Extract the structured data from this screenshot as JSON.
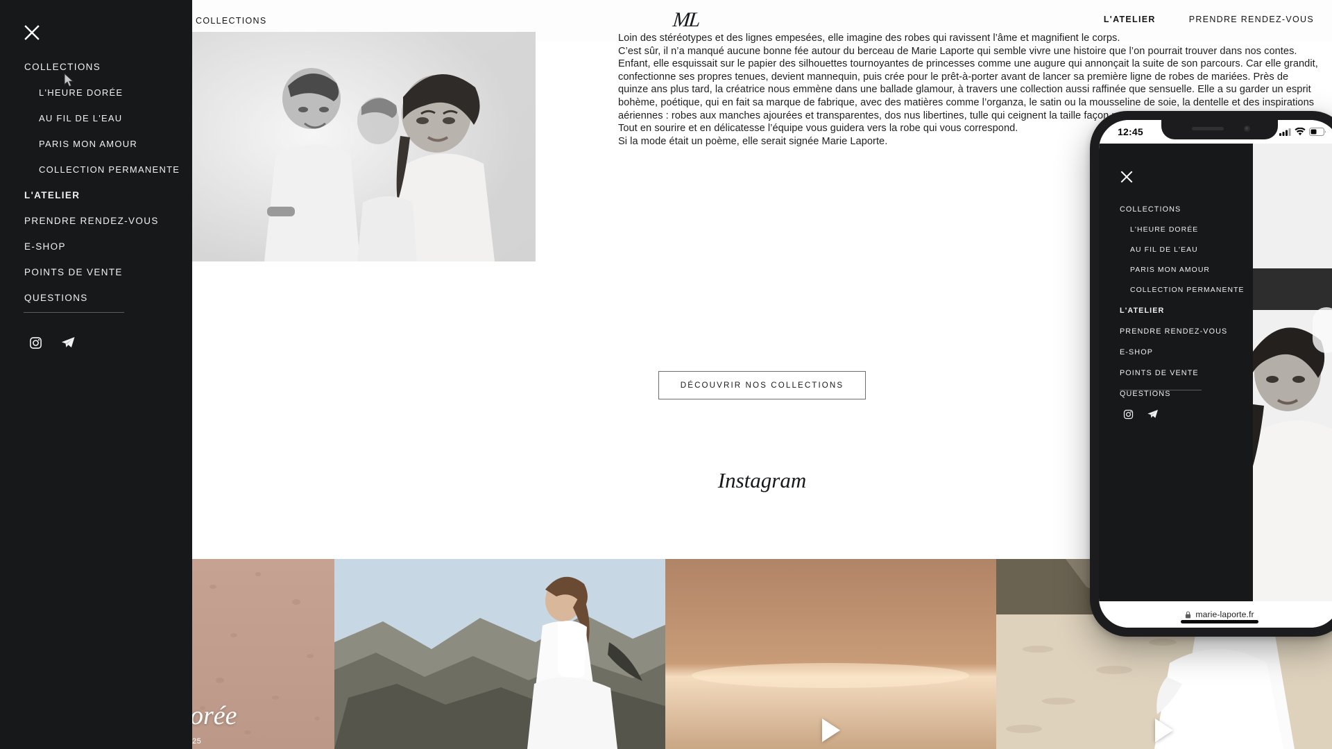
{
  "sidebar": {
    "close_icon": "close-x-icon",
    "items": [
      {
        "label": "COLLECTIONS",
        "level": "top",
        "active": false
      },
      {
        "label": "L'HEURE DORÉE",
        "level": "sub",
        "active": false
      },
      {
        "label": "AU FIL DE L'EAU",
        "level": "sub",
        "active": false
      },
      {
        "label": "PARIS MON AMOUR",
        "level": "sub",
        "active": false
      },
      {
        "label": "COLLECTION PERMANENTE",
        "level": "sub",
        "active": false
      },
      {
        "label": "L'ATELIER",
        "level": "top",
        "active": true
      },
      {
        "label": "PRENDRE RENDEZ-VOUS",
        "level": "top",
        "active": false
      },
      {
        "label": "E-SHOP",
        "level": "top",
        "active": false
      },
      {
        "label": "POINTS DE VENTE",
        "level": "top",
        "active": false
      },
      {
        "label": "QUESTIONS",
        "level": "top",
        "active": false
      }
    ],
    "social": [
      {
        "name": "instagram-icon"
      },
      {
        "name": "telegram-icon"
      }
    ]
  },
  "header": {
    "left_link": "COLLECTIONS",
    "logo": "ML",
    "right_links": [
      {
        "label": "L'ATELIER",
        "bold": true
      },
      {
        "label": "PRENDRE RENDEZ-VOUS",
        "bold": false
      }
    ]
  },
  "main": {
    "hero_image_alt": "atelier-fitting-photo",
    "paragraphs": [
      "Loin des stéréotypes et des lignes empesées, elle imagine des robes qui ravissent l’âme et magnifient le corps.",
      "C’est sûr, il n’a manqué aucune bonne fée autour du berceau de Marie Laporte qui semble vivre une histoire que l’on pourrait trouver dans nos contes. Enfant, elle esquissait sur le papier des silhouettes tournoyantes de princesses comme une augure qui annonçait la suite de son parcours. Car elle grandit, confectionne ses propres tenues, devient mannequin, puis crée pour le prêt-à-porter avant de lancer sa première ligne de robes de mariées. Près de quinze ans plus tard, la créatrice nous emmène dans une ballade glamour, à travers une collection aussi raffinée que sensuelle. Elle a su garder un esprit bohème, poétique, qui en fait sa marque de fabrique, avec des matières comme l’organza, le satin ou la mousseline de soie, la dentelle et des inspirations aériennes : robes aux manches ajourées et transparentes, dos nus libertines, tulle qui ceignent la taille façon nuage ...",
      "Tout en sourire et en délicatesse l’équipe vous guidera vers la robe qui vous correspond.",
      "Si la mode était un poème, elle serait signée Marie Laporte."
    ],
    "cta_label": "DÉCOUVRIR NOS COLLECTIONS",
    "instagram_heading": "Instagram",
    "gallery": [
      {
        "name": "tile-heure-doree",
        "caption": "dorée",
        "number": "25",
        "has_play": false
      },
      {
        "name": "tile-bride-rocks",
        "caption": "",
        "number": "",
        "has_play": false
      },
      {
        "name": "tile-beach-sunset",
        "caption": "",
        "number": "",
        "has_play": true
      },
      {
        "name": "tile-bride-beach",
        "caption": "",
        "number": "",
        "has_play": true
      }
    ]
  },
  "phone": {
    "status": {
      "time": "12:45",
      "signal_icon": "cellular-signal-icon",
      "wifi_icon": "wifi-icon",
      "battery_icon": "battery-icon"
    },
    "close_icon": "close-x-icon",
    "menu_items": [
      {
        "label": "COLLECTIONS",
        "level": "top",
        "active": false
      },
      {
        "label": "L'HEURE DORÉE",
        "level": "sub",
        "active": false
      },
      {
        "label": "AU FIL DE L'EAU",
        "level": "sub",
        "active": false
      },
      {
        "label": "PARIS MON AMOUR",
        "level": "sub",
        "active": false
      },
      {
        "label": "COLLECTION PERMANENTE",
        "level": "sub",
        "active": false
      },
      {
        "label": "L'ATELIER",
        "level": "top",
        "active": true
      },
      {
        "label": "PRENDRE RENDEZ-VOUS",
        "level": "top",
        "active": false
      },
      {
        "label": "E-SHOP",
        "level": "top",
        "active": false
      },
      {
        "label": "POINTS DE VENTE",
        "level": "top",
        "active": false
      },
      {
        "label": "QUESTIONS",
        "level": "top",
        "active": false
      }
    ],
    "social": [
      {
        "name": "instagram-icon"
      },
      {
        "name": "telegram-icon"
      }
    ],
    "url": "marie-laporte.fr",
    "lock_icon": "lock-icon"
  },
  "colors": {
    "menu_bg": "#16181a",
    "page_bg": "#ffffff",
    "cream_bg": "#faf8f5",
    "text": "#1e1e1e",
    "menu_text": "#f2f2f2"
  }
}
